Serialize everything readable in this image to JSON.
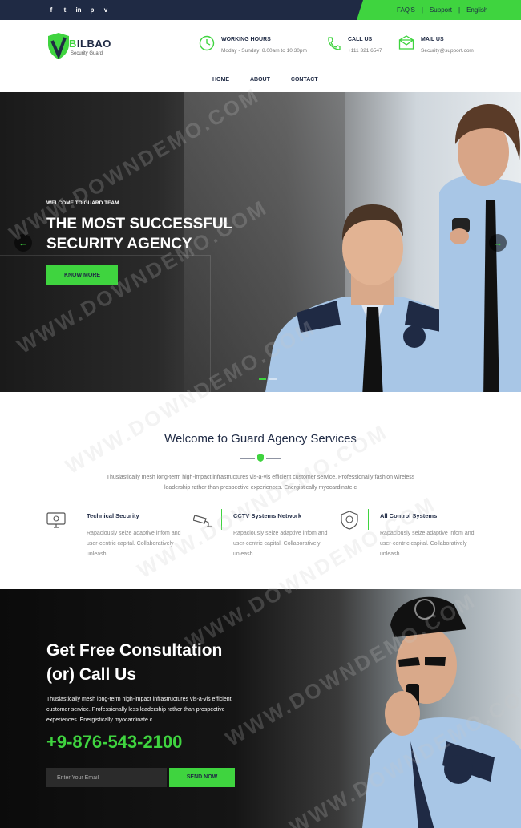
{
  "topbar": {
    "socials": [
      "f",
      "t",
      "in",
      "p",
      "v"
    ],
    "links": [
      "FAQ'S",
      "Support",
      "English"
    ]
  },
  "brand": {
    "name_prefix": "B",
    "name_rest": "ILBAO",
    "tagline": "Security Guard"
  },
  "header": {
    "hours": {
      "title": "WORKING HOURS",
      "value": "Moday - Sunday: 8.00am to 10.30pm"
    },
    "call": {
      "title": "CALL US",
      "value": "+111 321 6547"
    },
    "mail": {
      "title": "MAIL US",
      "value": "Security@support.com"
    }
  },
  "nav": [
    "HOME",
    "ABOUT",
    "CONTACT"
  ],
  "hero": {
    "kicker": "WELCOME TO GUARD TEAM",
    "title_line1": "THE MOST SUCCESSFUL",
    "title_line2": "SECURITY AGENCY",
    "button": "KNOW MORE",
    "prev": "←",
    "next": "→"
  },
  "welcome": {
    "title": "Welcome to Guard Agency Services",
    "lead_line1": "Thusiastically mesh long-term high-impact infrastructures vis-a-vis efficient customer service. Professionally fashion wireless",
    "lead_line2": "leadership rather than prospective experiences. Energistically myocardinate c",
    "features": [
      {
        "icon": "monitor-icon",
        "title": "Technical Security",
        "desc": "Rapaciously seize adaptive infom and user-centric capital. Collaboratively unleash"
      },
      {
        "icon": "cctv-camera-icon",
        "title": "CCTV Systems Network",
        "desc": "Rapaciously seize adaptive infom and user-centric capital. Collaboratively unleash"
      },
      {
        "icon": "shield-icon",
        "title": "All Control Systems",
        "desc": "Rapaciously seize adaptive infom and user-centric capital. Collaboratively unleash"
      }
    ]
  },
  "consult": {
    "title_line1": "Get Free Consultation",
    "title_line2": "(or) Call Us",
    "text": "Thusiastically mesh long-term high-impact infrastructures vis-a-vis efficient customer service. Professionally less leadership rather than prospective experiences. Energistically myocardinate c",
    "phone": "+9-876-543-2100",
    "email_placeholder": "Enter Your Email",
    "button": "SEND NOW"
  },
  "watermark": "WWW.DOWNDEMO.COM",
  "colors": {
    "accent": "#3fd43f",
    "navy": "#1f2a44"
  }
}
